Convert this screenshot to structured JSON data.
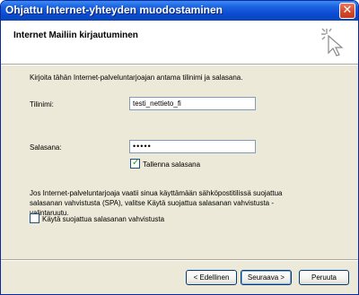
{
  "window": {
    "title": "Ohjattu Internet-yhteyden muodostaminen",
    "close_glyph": "✕"
  },
  "header": {
    "title": "Internet Mailiin kirjautuminen",
    "icon": "wizard-cursor-icon"
  },
  "content": {
    "instruction": "Kirjoita tähän Internet-palveluntarjoajan antama tilinimi ja salasana.",
    "account_label": "Tilinimi:",
    "account_value": "testi_nettieto_fi",
    "password_label": "Salasana:",
    "password_value": "•••••",
    "remember_password_label": "Tallenna salasana",
    "remember_password_checked": true,
    "spa_text": "Jos Internet-palveluntarjoaja vaatii sinua käyttämään sähköpostitilissä suojattua salasanan vahvistusta (SPA), valitse Käytä suojattua salasanan vahvistusta -valintaruutu.",
    "spa_checkbox_label": "Käytä suojattua salasanan vahvistusta",
    "spa_checked": false
  },
  "buttons": {
    "back": "< Edellinen",
    "next": "Seuraava >",
    "cancel": "Peruuta"
  },
  "colors": {
    "titlebar": "#0a4ad2",
    "dialog_bg": "#ece9d8",
    "close_button": "#d4482a",
    "checkmark": "#21a121"
  }
}
